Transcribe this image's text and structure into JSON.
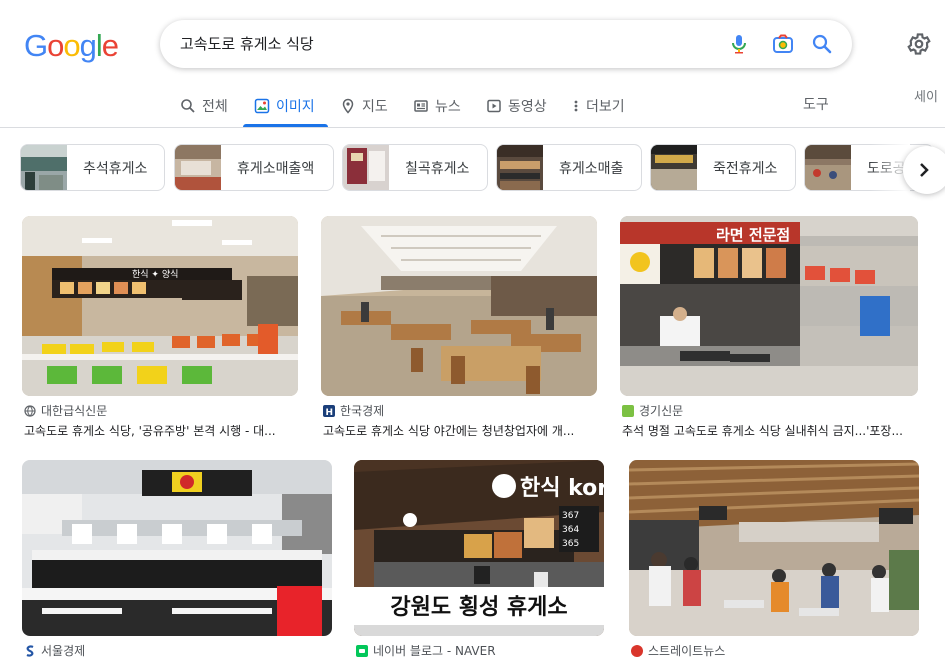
{
  "logo": {
    "letters": [
      "G",
      "o",
      "o",
      "g",
      "l",
      "e"
    ],
    "colors": [
      "#4285f4",
      "#ea4335",
      "#fbbc05",
      "#4285f4",
      "#34a853",
      "#ea4335"
    ]
  },
  "search": {
    "query": "고속도로 휴게소 식당"
  },
  "signin_partial": "세이",
  "tabs": [
    {
      "label": "전체",
      "icon": "search-icon"
    },
    {
      "label": "이미지",
      "icon": "image-icon",
      "active": true
    },
    {
      "label": "지도",
      "icon": "map-pin-icon"
    },
    {
      "label": "뉴스",
      "icon": "news-icon"
    },
    {
      "label": "동영상",
      "icon": "video-icon"
    },
    {
      "label": "더보기",
      "icon": "more-vert-icon"
    }
  ],
  "tools_label": "도구",
  "chips": [
    {
      "label": "추석휴게소"
    },
    {
      "label": "휴게소매출액"
    },
    {
      "label": "칠곡휴게소"
    },
    {
      "label": "휴게소매출"
    },
    {
      "label": "죽전휴게소"
    },
    {
      "label": "도로공"
    }
  ],
  "results": [
    {
      "source": "대한급식신문",
      "title": "고속도로 휴게소 식당, '공유주방' 본격 시행 - 대...",
      "sign_text": "한식 ✦ 양식"
    },
    {
      "source": "한국경제",
      "title": "고속도로 휴게소 식당 야간에는 청년창업자에 개...",
      "sign_text": ""
    },
    {
      "source": "경기신문",
      "title": "추석 명절 고속도로 휴게소 식당 실내취식 금지...'포장...",
      "sign_text": "라면 전문점"
    },
    {
      "source": "서울경제",
      "title": "",
      "sign_text": ""
    },
    {
      "source": "네이버 블로그 - NAVER",
      "title": "",
      "sign_text": "한식 korean food",
      "caption": "강원도 횡성 휴게소",
      "menu_numbers": [
        "367",
        "364",
        "365"
      ]
    },
    {
      "source": "스트레이트뉴스",
      "title": "",
      "sign_text": ""
    }
  ]
}
